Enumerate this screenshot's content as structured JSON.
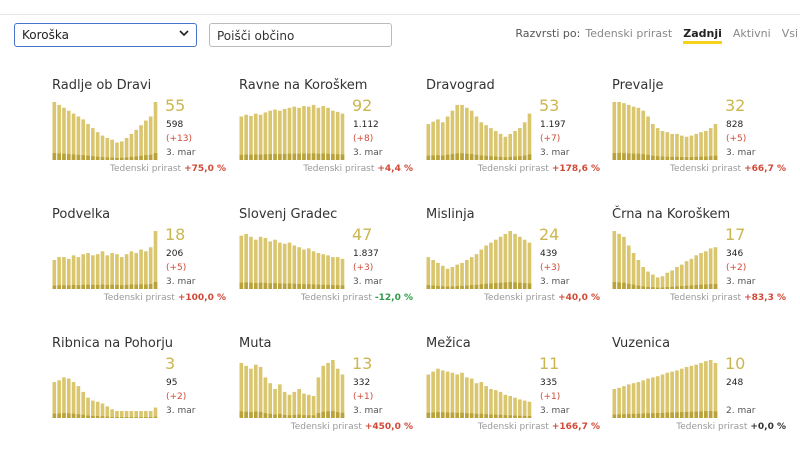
{
  "region_select": {
    "value": "Koroška"
  },
  "search": {
    "placeholder": "Poišči občino"
  },
  "sort": {
    "label": "Razvrsti po:",
    "options": [
      {
        "label": "Tedenski prirast",
        "active": false
      },
      {
        "label": "Zadnji",
        "active": true
      },
      {
        "label": "Aktivni",
        "active": false
      },
      {
        "label": "Vsi",
        "active": false
      }
    ]
  },
  "growth_label": "Tedenski prirast",
  "colors": {
    "bar": "#d9c66e",
    "bar_dark": "#b9a23a",
    "accent": "#f5d31d",
    "positive": "#d14a37",
    "negative": "#2e9c4a"
  },
  "municipalities": [
    {
      "name": "Radlje ob Dravi",
      "active": "55",
      "total": "598",
      "delta": "(+13)",
      "date": "3. mar",
      "growth": "+75,0 %",
      "trend": "pos",
      "series": [
        1.0,
        0.95,
        0.9,
        0.85,
        0.8,
        0.75,
        0.7,
        0.62,
        0.55,
        0.48,
        0.42,
        0.38,
        0.35,
        0.3,
        0.32,
        0.38,
        0.45,
        0.52,
        0.6,
        0.68,
        0.75,
        1.0
      ]
    },
    {
      "name": "Ravne na Koroškem",
      "active": "92",
      "total": "1.112",
      "delta": "(+8)",
      "date": "3. mar",
      "growth": "+4,4 %",
      "trend": "pos",
      "series": [
        0.75,
        0.78,
        0.76,
        0.8,
        0.78,
        0.82,
        0.85,
        0.87,
        0.85,
        0.88,
        0.9,
        0.92,
        0.9,
        0.93,
        0.92,
        0.95,
        0.9,
        0.93,
        0.9,
        0.85,
        0.83,
        0.8
      ]
    },
    {
      "name": "Dravograd",
      "active": "53",
      "total": "1.197",
      "delta": "(+7)",
      "date": "3. mar",
      "growth": "+178,6 %",
      "trend": "pos",
      "series": [
        0.62,
        0.66,
        0.7,
        0.65,
        0.75,
        0.85,
        0.95,
        0.95,
        0.9,
        0.85,
        0.75,
        0.65,
        0.6,
        0.55,
        0.5,
        0.45,
        0.4,
        0.45,
        0.5,
        0.55,
        0.65,
        0.8
      ]
    },
    {
      "name": "Prevalje",
      "active": "32",
      "total": "828",
      "delta": "(+5)",
      "date": "3. mar",
      "growth": "+66,7 %",
      "trend": "pos",
      "series": [
        1.0,
        1.0,
        0.98,
        0.95,
        0.92,
        0.9,
        0.85,
        0.75,
        0.62,
        0.55,
        0.5,
        0.48,
        0.45,
        0.45,
        0.42,
        0.4,
        0.42,
        0.45,
        0.48,
        0.5,
        0.55,
        0.62
      ]
    },
    {
      "name": "Podvelka",
      "active": "18",
      "total": "206",
      "delta": "(+5)",
      "date": "3. mar",
      "growth": "+100,0 %",
      "trend": "pos",
      "series": [
        0.5,
        0.55,
        0.55,
        0.52,
        0.58,
        0.55,
        0.6,
        0.62,
        0.58,
        0.6,
        0.65,
        0.58,
        0.62,
        0.6,
        0.55,
        0.6,
        0.65,
        0.62,
        0.68,
        0.65,
        0.72,
        1.0
      ]
    },
    {
      "name": "Slovenj Gradec",
      "active": "47",
      "total": "1.837",
      "delta": "(+3)",
      "date": "3. mar",
      "growth": "-12,0 %",
      "trend": "neg",
      "series": [
        0.92,
        0.95,
        0.9,
        0.85,
        0.9,
        0.88,
        0.82,
        0.85,
        0.8,
        0.78,
        0.8,
        0.75,
        0.72,
        0.68,
        0.7,
        0.65,
        0.62,
        0.6,
        0.58,
        0.55,
        0.55,
        0.52
      ]
    },
    {
      "name": "Mislinja",
      "active": "24",
      "total": "439",
      "delta": "(+3)",
      "date": "3. mar",
      "growth": "+40,0 %",
      "trend": "pos",
      "series": [
        0.55,
        0.5,
        0.45,
        0.4,
        0.35,
        0.38,
        0.42,
        0.45,
        0.5,
        0.55,
        0.6,
        0.68,
        0.75,
        0.8,
        0.85,
        0.9,
        0.95,
        1.0,
        0.95,
        0.9,
        0.85,
        0.8
      ]
    },
    {
      "name": "Črna na Koroškem",
      "active": "17",
      "total": "346",
      "delta": "(+2)",
      "date": "3. mar",
      "growth": "+83,3 %",
      "trend": "pos",
      "series": [
        1.0,
        0.95,
        0.9,
        0.75,
        0.62,
        0.5,
        0.38,
        0.3,
        0.25,
        0.2,
        0.22,
        0.28,
        0.32,
        0.38,
        0.42,
        0.48,
        0.52,
        0.58,
        0.62,
        0.65,
        0.7,
        0.72
      ]
    },
    {
      "name": "Ribnica na Pohorju",
      "active": "3",
      "total": "95",
      "delta": "(+2)",
      "date": "3. mar",
      "growth": "",
      "trend": "pos",
      "series": [
        0.62,
        0.65,
        0.7,
        0.68,
        0.62,
        0.55,
        0.45,
        0.35,
        0.3,
        0.28,
        0.25,
        0.2,
        0.15,
        0.12,
        0.12,
        0.12,
        0.12,
        0.12,
        0.12,
        0.12,
        0.12,
        0.18
      ]
    },
    {
      "name": "Muta",
      "active": "13",
      "total": "332",
      "delta": "(+1)",
      "date": "3. mar",
      "growth": "+450,0 %",
      "trend": "pos",
      "series": [
        0.95,
        0.9,
        0.85,
        0.92,
        0.88,
        0.7,
        0.6,
        0.5,
        0.58,
        0.45,
        0.4,
        0.45,
        0.5,
        0.42,
        0.4,
        0.38,
        0.7,
        0.9,
        0.95,
        1.0,
        0.85,
        0.75
      ]
    },
    {
      "name": "Mežica",
      "active": "11",
      "total": "335",
      "delta": "(+1)",
      "date": "3. mar",
      "growth": "+166,7 %",
      "trend": "pos",
      "series": [
        0.75,
        0.8,
        0.85,
        0.82,
        0.8,
        0.78,
        0.75,
        0.78,
        0.7,
        0.68,
        0.6,
        0.62,
        0.55,
        0.5,
        0.48,
        0.45,
        0.4,
        0.38,
        0.35,
        0.32,
        0.3,
        0.28
      ]
    },
    {
      "name": "Vuzenica",
      "active": "10",
      "total": "248",
      "delta": "",
      "date": "2. mar",
      "growth": "+0,0 %",
      "trend": "zero",
      "series": [
        0.5,
        0.52,
        0.55,
        0.58,
        0.6,
        0.62,
        0.65,
        0.68,
        0.7,
        0.72,
        0.75,
        0.78,
        0.8,
        0.82,
        0.85,
        0.88,
        0.9,
        0.92,
        0.95,
        0.98,
        1.0,
        0.95
      ]
    }
  ]
}
